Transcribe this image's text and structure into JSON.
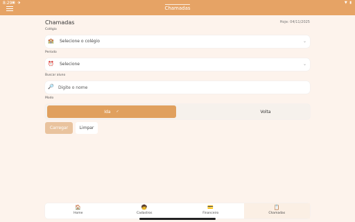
{
  "status": {
    "time": "8:29",
    "left_icons": "▣ ⬗",
    "right_icons": "▼ ▮"
  },
  "header": {
    "title": "Chamadas"
  },
  "page": {
    "title": "Chamadas",
    "date": "Hoje: 04/11/2025"
  },
  "colegio": {
    "label": "Colégio",
    "value": "Selecione o colégio",
    "icon": "school-icon"
  },
  "periodo": {
    "label": "Período",
    "value": "Selecione",
    "icon": "alarm-clock-icon"
  },
  "buscar": {
    "label": "Buscar aluno",
    "placeholder": "Digite o nome",
    "icon": "search-icon"
  },
  "modo": {
    "label": "Modo",
    "options": [
      "Ida",
      "Volta"
    ],
    "selected": "Ida",
    "check": "✓"
  },
  "actions": {
    "carregar": "Carregar",
    "limpar": "Limpar"
  },
  "nav": [
    {
      "label": "Home",
      "icon": "🏠"
    },
    {
      "label": "Cadastros",
      "icon": "🧒"
    },
    {
      "label": "Financeiro",
      "icon": "💳"
    },
    {
      "label": "Chamadas",
      "icon": "📋"
    }
  ],
  "colors": {
    "accent": "#e6a365",
    "selected_mode": "#e0a05e",
    "background": "#fdf3ec"
  }
}
